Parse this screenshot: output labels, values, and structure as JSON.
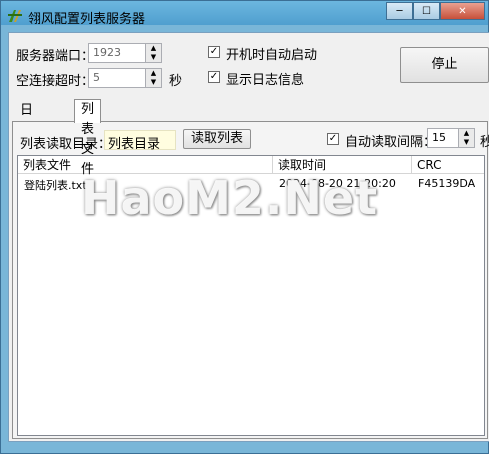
{
  "window": {
    "title": "翎风配置列表服务器",
    "minimize": "─",
    "maximize": "☐",
    "close": "✕"
  },
  "settings": {
    "port_label": "服务器端口：",
    "port_value": "1923",
    "idle_timeout_label": "空连接超时：",
    "idle_timeout_value": "5",
    "idle_timeout_unit": "秒",
    "autostart_label": "开机时自动启动",
    "autostart_checked": true,
    "showlog_label": "显示日志信息",
    "showlog_checked": true,
    "stop_button": "停止"
  },
  "tabs": [
    {
      "label": "日志显示"
    },
    {
      "label": "列表文件"
    }
  ],
  "listfile": {
    "dir_label": "列表读取目录：",
    "dir_value": "列表目录",
    "read_button": "读取列表",
    "autoread_label": "自动读取",
    "autoread_checked": true,
    "interval_label": "间隔：",
    "interval_value": "15",
    "interval_unit": "秒",
    "columns": [
      "列表文件",
      "读取时间",
      "CRC"
    ],
    "rows": [
      {
        "file": "登陆列表.txt",
        "time": "2024-08-20 21:20:20",
        "crc": "F45139DA"
      }
    ]
  },
  "watermark": "HaoM2.Net"
}
